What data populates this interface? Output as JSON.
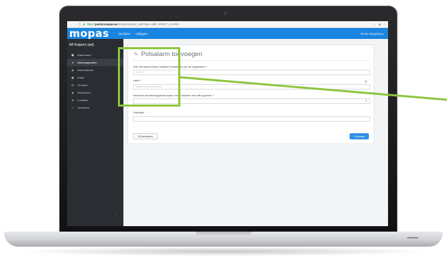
{
  "browser": {
    "nav_icons": "← →  C",
    "protocol": "https://",
    "host": "portal.mopas.eu",
    "path": "/tracker/tracker_edit?type=888_WRIST_ALARM"
  },
  "topnav": {
    "logo": "mopas",
    "links": [
      "Bedrijven",
      "Uitloggen"
    ],
    "environment": "Demo omgeving ▾"
  },
  "sidebar": {
    "title": "WI Kuipers (ad)",
    "items": [
      {
        "label": "Dashboard",
        "icon": "dashboard-icon",
        "glyph": "◼"
      },
      {
        "label": "Alarmapparaten",
        "icon": "marker-icon",
        "glyph": "♦"
      },
      {
        "label": "Alarmhistorie",
        "icon": "bell-icon",
        "glyph": "▲"
      },
      {
        "label": "Kaart",
        "icon": "compass-icon",
        "glyph": "◉"
      },
      {
        "label": "Groepen",
        "icon": "group-icon",
        "glyph": "◘"
      },
      {
        "label": "Gebruikers",
        "icon": "user-icon",
        "glyph": "▲"
      },
      {
        "label": "Locaties",
        "icon": "location-icon",
        "glyph": "♦"
      },
      {
        "label": "Geofence",
        "icon": "geofence-icon",
        "glyph": "○"
      }
    ],
    "active_index": 1,
    "collapse_glyph": "‹"
  },
  "form": {
    "title": "Polsalarm toevoegen",
    "imei_label": "Voer het serienummer (laatste 6 karakters) van het apparaat in *",
    "imei_placeholder": "XXXXX",
    "label_label": "Label *",
    "label_placeholder": "unieke/in gebruik Mosas",
    "group_label": "Selecteer het alarmapparaat waar u het u strukker aan wilt koppelen. *",
    "user_label": "Gebruiker",
    "cancel_label": "Annuleren",
    "save_label": "Opslaan",
    "help_glyph": "?"
  },
  "annotation": {
    "color": "#8cc63f"
  },
  "colors": {
    "brand_blue": "#1985e0",
    "sidebar_bg": "#2a2e33",
    "save_button": "#2f8fe5"
  }
}
